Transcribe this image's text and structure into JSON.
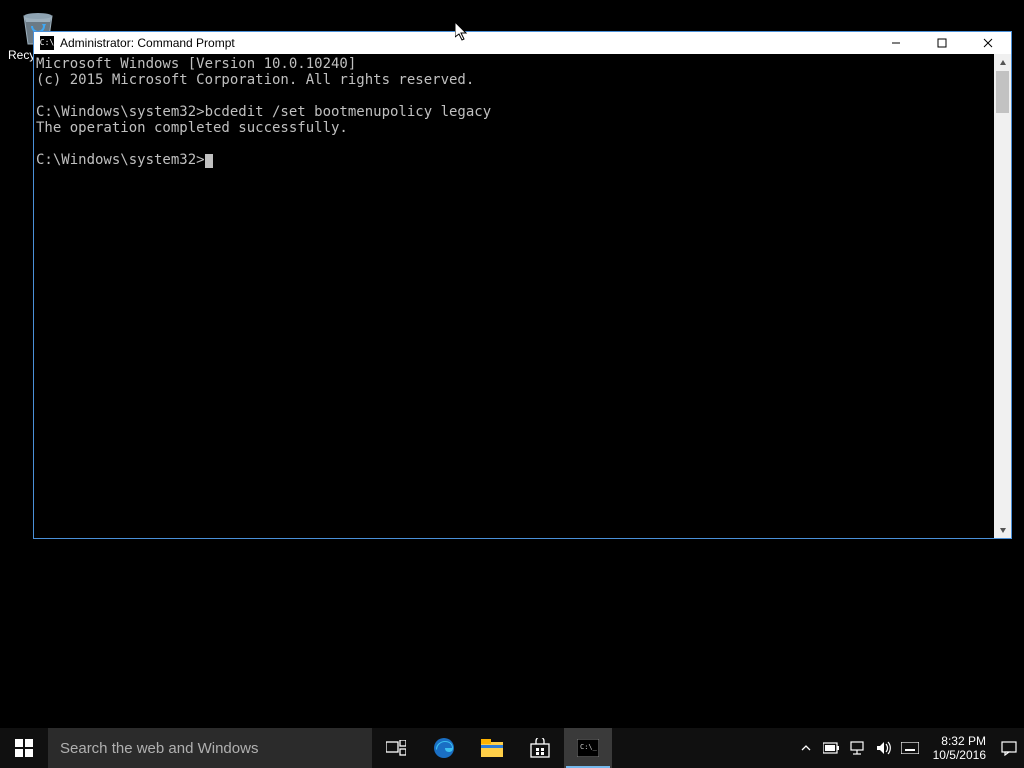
{
  "desktop": {
    "recycle_bin_label": "Recycle Bin"
  },
  "window": {
    "title": "Administrator: Command Prompt",
    "terminal_lines": [
      "Microsoft Windows [Version 10.0.10240]",
      "(c) 2015 Microsoft Corporation. All rights reserved.",
      "",
      "C:\\Windows\\system32>bcdedit /set bootmenupolicy legacy",
      "The operation completed successfully.",
      "",
      "C:\\Windows\\system32>"
    ]
  },
  "taskbar": {
    "search_placeholder": "Search the web and Windows",
    "time": "8:32 PM",
    "date": "10/5/2016"
  }
}
